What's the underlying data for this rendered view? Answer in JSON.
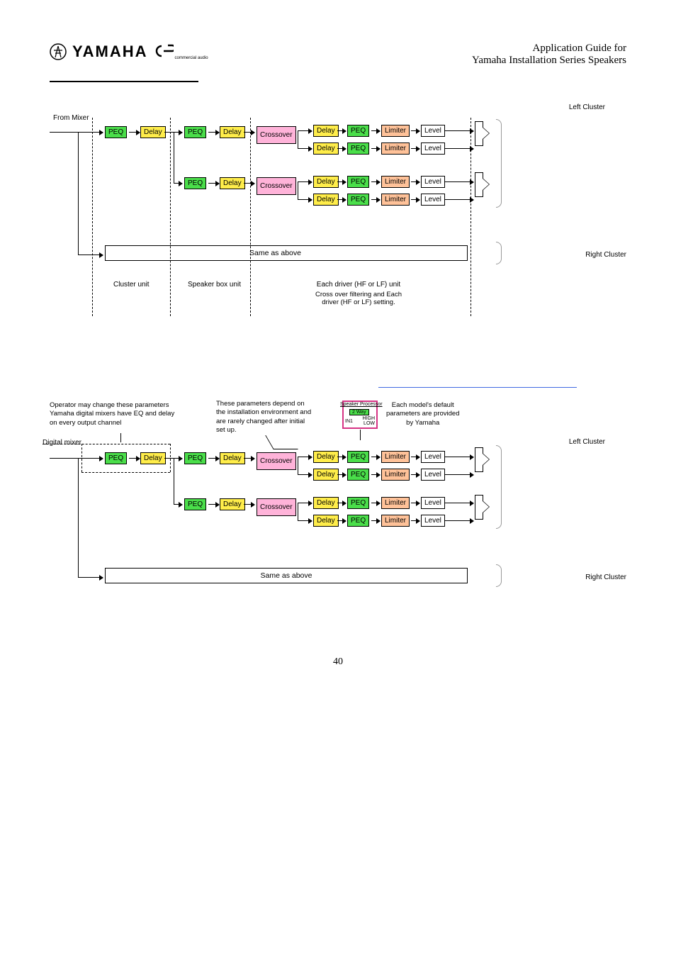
{
  "header": {
    "logo_text": "YAMAHA",
    "logo_ca": "commercial audio",
    "title_line1": "Application Guide for",
    "title_line2": "Yamaha Installation Series Speakers"
  },
  "blocks": {
    "peq": "PEQ",
    "delay": "Delay",
    "crossover": "Crossover",
    "limiter": "Limiter",
    "level": "Level"
  },
  "labels": {
    "from_mixer": "From Mixer",
    "left_cluster": "Left Cluster",
    "right_cluster": "Right Cluster",
    "same_as_above": "Same as above",
    "cluster_unit": "Cluster unit",
    "speaker_box_unit": "Speaker box unit",
    "driver_unit": "Each driver (HF or LF) unit",
    "driver_unit_sub": "Cross over filtering and Each\ndriver (HF or LF) setting.",
    "digital_mixer": "Digital mixer",
    "annot1": "Operator may change these parameters\nYamaha digital mixers have EQ and delay\non every output channel",
    "annot2": "These parameters depend on\nthe installation environment and\nare rarely changed after initial\nset up.",
    "annot3": "Each model's default\nparameters are provided\nby Yamaha",
    "sp_title": "Speaker Processor",
    "sp_2way": "2 Way",
    "sp_in": "IN1",
    "sp_hl": "HIGH\nLOW"
  },
  "page_number": "40"
}
